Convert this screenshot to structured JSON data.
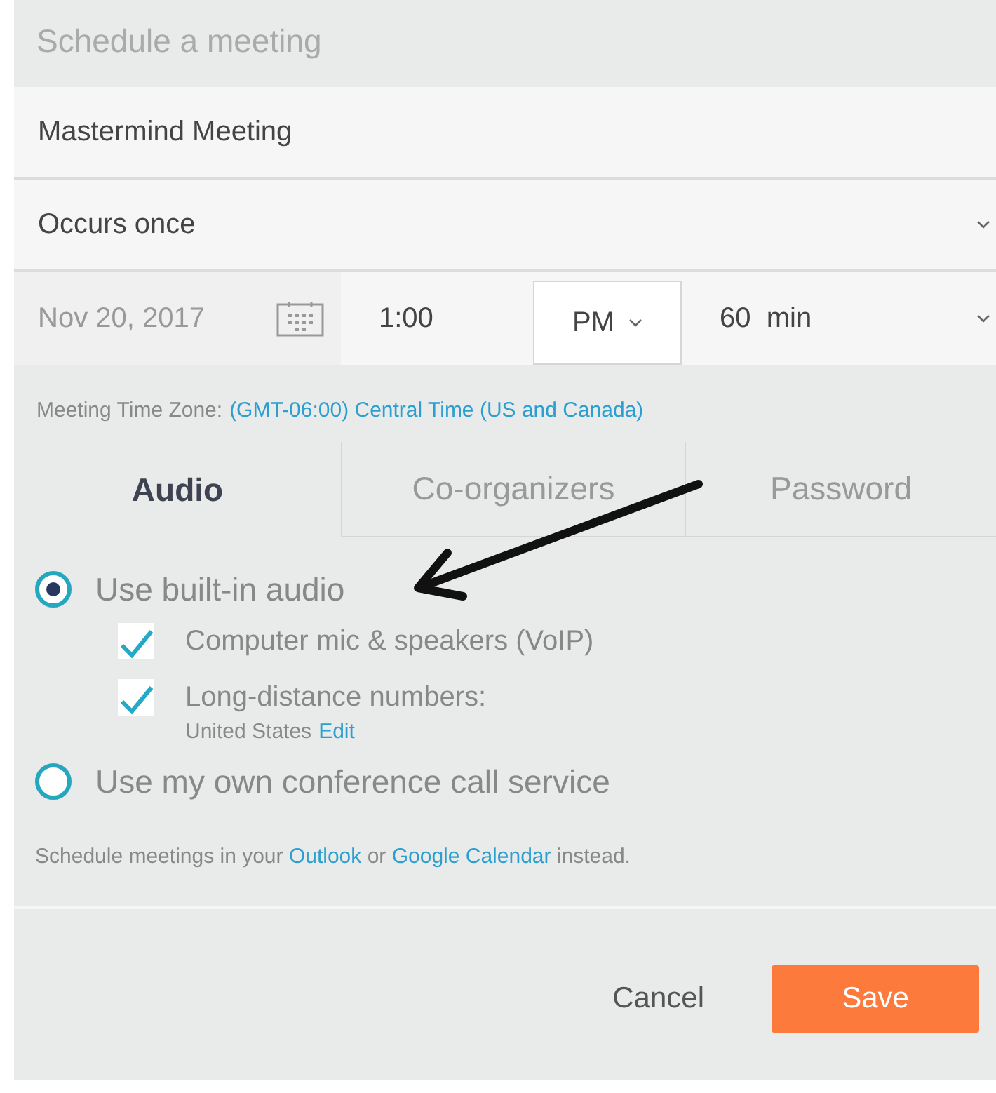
{
  "title": "Schedule a meeting",
  "topic": {
    "value": "Mastermind Meeting"
  },
  "recurrence": {
    "value": "Occurs once"
  },
  "date": {
    "value": "Nov 20, 2017"
  },
  "time": {
    "value": "1:00"
  },
  "ampm": {
    "value": "PM"
  },
  "duration": {
    "value": "60  min"
  },
  "timezone": {
    "label": "Meeting Time Zone:",
    "link": "(GMT-06:00) Central Time (US and Canada)"
  },
  "tabs": [
    {
      "label": "Audio",
      "selected": true
    },
    {
      "label": "Co-organizers",
      "selected": false
    },
    {
      "label": "Password",
      "selected": false
    }
  ],
  "audio_options": [
    {
      "label": "Use built-in audio",
      "selected": true,
      "children": [
        {
          "label": "Computer mic & speakers (VoIP)",
          "checked": true
        },
        {
          "label": "Long-distance numbers:",
          "checked": true,
          "detail": "United States",
          "link": "Edit"
        }
      ]
    },
    {
      "label": "Use my own conference call service",
      "selected": false
    }
  ],
  "footer_note": [
    {
      "kind": "text",
      "text": "Schedule meetings in your"
    },
    {
      "kind": "link",
      "text": "Outlook"
    },
    {
      "kind": "text",
      "text": "or"
    },
    {
      "kind": "link",
      "text": "Google Calendar"
    },
    {
      "kind": "text",
      "text": "instead."
    }
  ],
  "buttons": [
    {
      "label": "Cancel",
      "kind": "secondary"
    },
    {
      "label": "Save",
      "kind": "primary"
    }
  ],
  "annotation": {
    "kind": "arrow"
  }
}
